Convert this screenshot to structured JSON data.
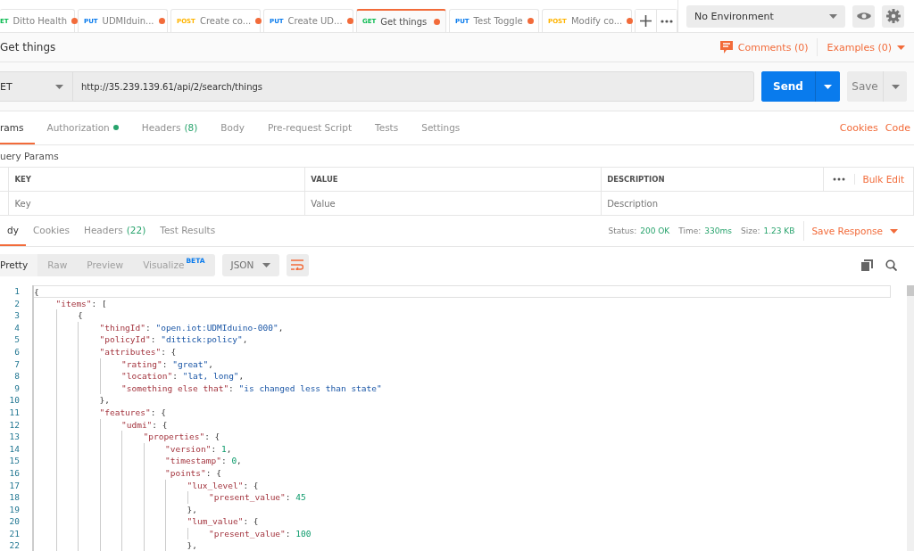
{
  "request_tabs": [
    {
      "method": "ET",
      "kind": "get",
      "name": "Ditto Health",
      "unsaved": true,
      "selected": false
    },
    {
      "method": "PUT",
      "kind": "put",
      "name": "UDMIduin...",
      "unsaved": true,
      "selected": false
    },
    {
      "method": "POST",
      "kind": "post",
      "name": "Create co...",
      "unsaved": true,
      "selected": false
    },
    {
      "method": "PUT",
      "kind": "put",
      "name": "Create UD...",
      "unsaved": true,
      "selected": false
    },
    {
      "method": "GET",
      "kind": "get",
      "name": "Get things",
      "unsaved": true,
      "selected": true
    },
    {
      "method": "PUT",
      "kind": "put",
      "name": "Test Toggle",
      "unsaved": true,
      "selected": false
    },
    {
      "method": "POST",
      "kind": "post",
      "name": "Modify co...",
      "unsaved": true,
      "selected": false
    }
  ],
  "environment": {
    "value": "No Environment"
  },
  "request": {
    "title": "Get things",
    "comments": "Comments (0)",
    "examples": "Examples (0)",
    "method": "ET",
    "url": "http://35.239.139.61/api/2/search/things",
    "send": "Send",
    "save": "Save"
  },
  "request_sections": [
    {
      "label": "rams",
      "dot": false,
      "selected": true
    },
    {
      "label": "Authorization",
      "dot": true,
      "selected": false
    },
    {
      "label": "Headers",
      "count": "(8)",
      "dot": false,
      "selected": false
    },
    {
      "label": "Body",
      "dot": false,
      "selected": false
    },
    {
      "label": "Pre-request Script",
      "dot": false,
      "selected": false
    },
    {
      "label": "Tests",
      "dot": false,
      "selected": false
    },
    {
      "label": "Settings",
      "dot": false,
      "selected": false
    }
  ],
  "request_links": [
    "Cookies",
    "Code"
  ],
  "query_params": {
    "title": "uery Params",
    "columns": [
      "KEY",
      "VALUE",
      "DESCRIPTION"
    ],
    "bulk_edit": "Bulk Edit",
    "placeholders": [
      "Key",
      "Value",
      "Description"
    ]
  },
  "response_sections": [
    {
      "label": "dy",
      "selected": true
    },
    {
      "label": "Cookies",
      "selected": false
    },
    {
      "label": "Headers",
      "count": "(22)",
      "selected": false
    },
    {
      "label": "Test Results",
      "selected": false
    }
  ],
  "response_stats": [
    {
      "label": "Status:",
      "value": "200 OK"
    },
    {
      "label": "Time:",
      "value": "330ms"
    },
    {
      "label": "Size:",
      "value": "1.23 KB"
    }
  ],
  "save_response": "Save Response",
  "view_modes": [
    {
      "label": "Pretty",
      "selected": true
    },
    {
      "label": "Raw",
      "selected": false
    },
    {
      "label": "Preview",
      "selected": false
    },
    {
      "label": "Visualize",
      "badge": "BETA",
      "selected": false
    }
  ],
  "format": "JSON",
  "code_lines": [
    {
      "number": "1",
      "tokens": [
        {
          "kind": "punct",
          "text": "{"
        }
      ],
      "children": [
        {
          "number": "2",
          "tokens": [
            {
              "kind": "key",
              "text": "\"items\""
            },
            {
              "kind": "punct",
              "text": ": ["
            }
          ],
          "children": [
            {
              "number": "3",
              "tokens": [
                {
                  "kind": "punct",
                  "text": "{"
                }
              ],
              "children": [
                {
                  "number": "4",
                  "tokens": [
                    {
                      "kind": "key",
                      "text": "\"thingId\""
                    },
                    {
                      "kind": "punct",
                      "text": ": "
                    },
                    {
                      "kind": "string",
                      "text": "\"open.iot:UDMIduino-000\""
                    },
                    {
                      "kind": "punct",
                      "text": ","
                    }
                  ]
                },
                {
                  "number": "5",
                  "tokens": [
                    {
                      "kind": "key",
                      "text": "\"policyId\""
                    },
                    {
                      "kind": "punct",
                      "text": ": "
                    },
                    {
                      "kind": "string",
                      "text": "\"dittick:policy\""
                    },
                    {
                      "kind": "punct",
                      "text": ","
                    }
                  ]
                },
                {
                  "number": "6",
                  "tokens": [
                    {
                      "kind": "key",
                      "text": "\"attributes\""
                    },
                    {
                      "kind": "punct",
                      "text": ": {"
                    }
                  ],
                  "children": [
                    {
                      "number": "7",
                      "tokens": [
                        {
                          "kind": "key",
                          "text": "\"rating\""
                        },
                        {
                          "kind": "punct",
                          "text": ": "
                        },
                        {
                          "kind": "string",
                          "text": "\"great\""
                        },
                        {
                          "kind": "punct",
                          "text": ","
                        }
                      ]
                    },
                    {
                      "number": "8",
                      "tokens": [
                        {
                          "kind": "key",
                          "text": "\"location\""
                        },
                        {
                          "kind": "punct",
                          "text": ": "
                        },
                        {
                          "kind": "string",
                          "text": "\"lat, long\""
                        },
                        {
                          "kind": "punct",
                          "text": ","
                        }
                      ]
                    },
                    {
                      "number": "9",
                      "tokens": [
                        {
                          "kind": "key",
                          "text": "\"something else that\""
                        },
                        {
                          "kind": "punct",
                          "text": ": "
                        },
                        {
                          "kind": "string",
                          "text": "\"is changed less than state\""
                        }
                      ]
                    }
                  ]
                },
                {
                  "number": "10",
                  "tokens": [
                    {
                      "kind": "punct",
                      "text": "},"
                    }
                  ]
                },
                {
                  "number": "11",
                  "tokens": [
                    {
                      "kind": "key",
                      "text": "\"features\""
                    },
                    {
                      "kind": "punct",
                      "text": ": {"
                    }
                  ],
                  "children": [
                    {
                      "number": "12",
                      "tokens": [
                        {
                          "kind": "key",
                          "text": "\"udmi\""
                        },
                        {
                          "kind": "punct",
                          "text": ": {"
                        }
                      ],
                      "children": [
                        {
                          "number": "13",
                          "tokens": [
                            {
                              "kind": "key",
                              "text": "\"properties\""
                            },
                            {
                              "kind": "punct",
                              "text": ": {"
                            }
                          ],
                          "children": [
                            {
                              "number": "14",
                              "tokens": [
                                {
                                  "kind": "key",
                                  "text": "\"version\""
                                },
                                {
                                  "kind": "punct",
                                  "text": ": "
                                },
                                {
                                  "kind": "number",
                                  "text": "1"
                                },
                                {
                                  "kind": "punct",
                                  "text": ","
                                }
                              ]
                            },
                            {
                              "number": "15",
                              "tokens": [
                                {
                                  "kind": "key",
                                  "text": "\"timestamp\""
                                },
                                {
                                  "kind": "punct",
                                  "text": ": "
                                },
                                {
                                  "kind": "number",
                                  "text": "0"
                                },
                                {
                                  "kind": "punct",
                                  "text": ","
                                }
                              ]
                            },
                            {
                              "number": "16",
                              "tokens": [
                                {
                                  "kind": "key",
                                  "text": "\"points\""
                                },
                                {
                                  "kind": "punct",
                                  "text": ": {"
                                }
                              ],
                              "children": [
                                {
                                  "number": "17",
                                  "tokens": [
                                    {
                                      "kind": "key",
                                      "text": "\"lux_level\""
                                    },
                                    {
                                      "kind": "punct",
                                      "text": ": {"
                                    }
                                  ],
                                  "children": [
                                    {
                                      "number": "18",
                                      "tokens": [
                                        {
                                          "kind": "key",
                                          "text": "\"present_value\""
                                        },
                                        {
                                          "kind": "punct",
                                          "text": ": "
                                        },
                                        {
                                          "kind": "number",
                                          "text": "45"
                                        }
                                      ]
                                    }
                                  ]
                                },
                                {
                                  "number": "19",
                                  "tokens": [
                                    {
                                      "kind": "punct",
                                      "text": "},"
                                    }
                                  ]
                                },
                                {
                                  "number": "20",
                                  "tokens": [
                                    {
                                      "kind": "key",
                                      "text": "\"lum_value\""
                                    },
                                    {
                                      "kind": "punct",
                                      "text": ": {"
                                    }
                                  ],
                                  "children": [
                                    {
                                      "number": "21",
                                      "tokens": [
                                        {
                                          "kind": "key",
                                          "text": "\"present_value\""
                                        },
                                        {
                                          "kind": "punct",
                                          "text": ": "
                                        },
                                        {
                                          "kind": "number",
                                          "text": "100"
                                        }
                                      ]
                                    }
                                  ]
                                },
                                {
                                  "number": "22",
                                  "tokens": [
                                    {
                                      "kind": "punct",
                                      "text": "},"
                                    }
                                  ]
                                }
                              ]
                            }
                          ]
                        }
                      ]
                    }
                  ]
                }
              ]
            }
          ]
        }
      ]
    }
  ]
}
